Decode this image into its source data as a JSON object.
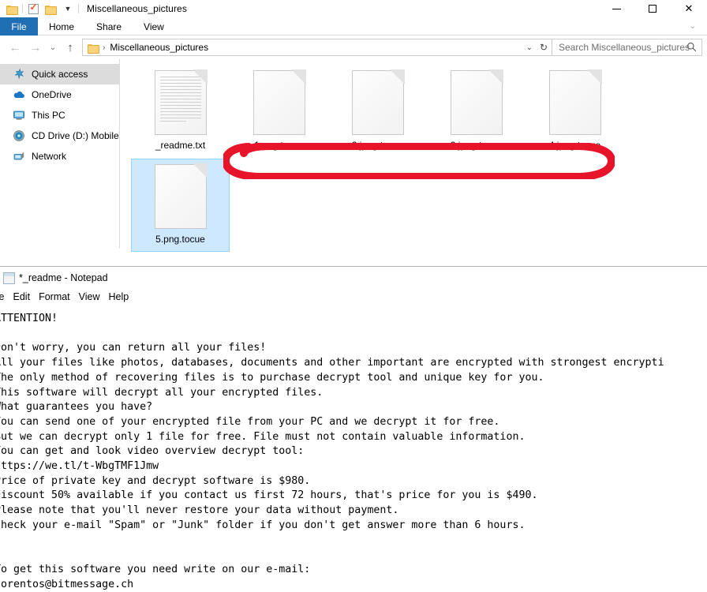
{
  "explorer": {
    "window_title": "Miscellaneous_pictures",
    "quick_access_toolbar": [
      {
        "name": "folder-icon",
        "label": ""
      },
      {
        "name": "properties-icon",
        "label": ""
      },
      {
        "name": "new-folder-icon",
        "label": ""
      },
      {
        "name": "customize-caret",
        "label": "▾"
      }
    ],
    "window_controls": {
      "minimize": "—",
      "maximize": "▢",
      "close": "✕"
    },
    "ribbon_tabs": [
      {
        "label": "File"
      },
      {
        "label": "Home"
      },
      {
        "label": "Share"
      },
      {
        "label": "View"
      }
    ],
    "ribbon_expand_icon": "⌄",
    "nav": {
      "back": "←",
      "forward": "→",
      "recent": "⌄",
      "up": "↑",
      "breadcrumb_separator": "›",
      "breadcrumb": "Miscellaneous_pictures",
      "address_caret": "⌄",
      "refresh": "↻"
    },
    "search": {
      "placeholder": "Search Miscellaneous_pictures",
      "value": ""
    },
    "sidebar": {
      "items": [
        {
          "label": "Quick access",
          "icon": "pin-icon",
          "selected": true
        },
        {
          "label": "OneDrive",
          "icon": "cloud-icon",
          "selected": false
        },
        {
          "label": "This PC",
          "icon": "monitor-icon",
          "selected": false
        },
        {
          "label": "CD Drive (D:) MobileW",
          "icon": "disc-icon",
          "selected": false
        },
        {
          "label": "Network",
          "icon": "network-icon",
          "selected": false
        }
      ]
    },
    "files": [
      {
        "name": "_readme.txt",
        "icon": "text-document-icon",
        "selected": false
      },
      {
        "name": "1.png.tocue",
        "icon": "blank-document-icon",
        "selected": false
      },
      {
        "name": "2.jpeg.tocue",
        "icon": "blank-document-icon",
        "selected": false
      },
      {
        "name": "3.jpeg.tocue",
        "icon": "blank-document-icon",
        "selected": false
      },
      {
        "name": "4.jpeg.tocue",
        "icon": "blank-document-icon",
        "selected": false
      },
      {
        "name": "5.png.tocue",
        "icon": "blank-document-icon",
        "selected": true
      }
    ],
    "annotation": {
      "shape": "hand-drawn-ellipse",
      "color": "#e8152a",
      "encircles": "1.png.tocue, 2.jpeg.tocue, 3.jpeg.tocue, 4.jpeg.tocue"
    }
  },
  "notepad": {
    "window_title": "*_readme - Notepad",
    "menu": [
      "ile",
      "Edit",
      "Format",
      "View",
      "Help"
    ],
    "body": "ATTENTION!\n\nDon't worry, you can return all your files!\nAll your files like photos, databases, documents and other important are encrypted with strongest encrypti\nThe only method of recovering files is to purchase decrypt tool and unique key for you.\nThis software will decrypt all your encrypted files.\nWhat guarantees you have?\nYou can send one of your encrypted file from your PC and we decrypt it for free.\nBut we can decrypt only 1 file for free. File must not contain valuable information.\nYou can get and look video overview decrypt tool:\nhttps://we.tl/t-WbgTMF1Jmw\nPrice of private key and decrypt software is $980.\nDiscount 50% available if you contact us first 72 hours, that's price for you is $490.\nPlease note that you'll never restore your data without payment.\nCheck your e-mail \"Spam\" or \"Junk\" folder if you don't get answer more than 6 hours.\n\n\nTo get this software you need write on our e-mail:\ngorentos@bitmessage.ch"
  },
  "colors": {
    "accent": "#1f6fb5",
    "annotation_red": "#e8152a",
    "selection_blue": "#cde8ff"
  }
}
